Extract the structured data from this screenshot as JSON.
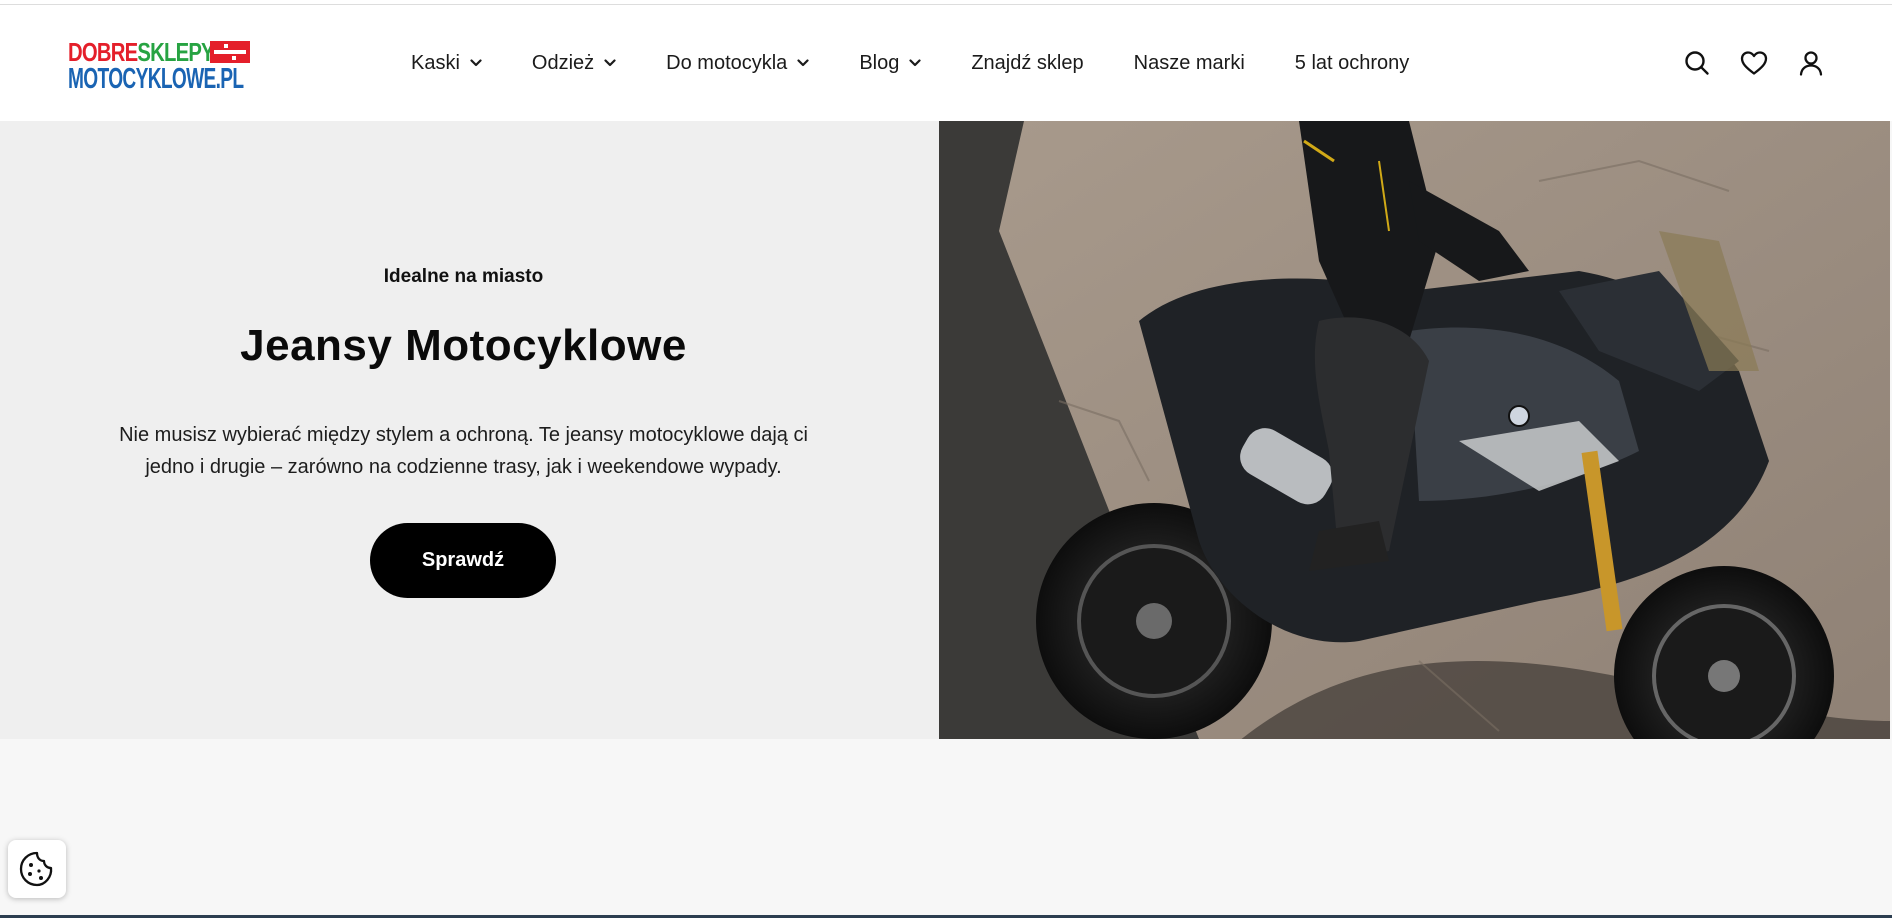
{
  "logo": {
    "line1_a": "DOBRE",
    "line1_b": "SKLEPY",
    "line2": "MOTOCYKLOWE.PL",
    "colors": {
      "red": "#e41f2a",
      "green": "#27a342",
      "blue": "#1a64b3"
    }
  },
  "nav": {
    "items": [
      {
        "label": "Kaski",
        "dropdown": true
      },
      {
        "label": "Odzież",
        "dropdown": true
      },
      {
        "label": "Do motocykla",
        "dropdown": true
      },
      {
        "label": "Blog",
        "dropdown": true
      },
      {
        "label": "Znajdź sklep",
        "dropdown": false
      },
      {
        "label": "Nasze marki",
        "dropdown": false
      },
      {
        "label": "5 lat ochrony",
        "dropdown": false
      }
    ]
  },
  "header_icons": [
    "search-icon",
    "heart-icon",
    "user-icon"
  ],
  "hero": {
    "eyebrow": "Idealne na miasto",
    "title": "Jeansy Motocyklowe",
    "description": "Nie musisz wybierać między stylem a ochroną. Te jeansy motocyklowe dają ci jedno i drugie – zarówno na codzienne trasy, jak i weekendowe wypady.",
    "cta_label": "Sprawdź",
    "image": "motorcycle-rider-photo"
  },
  "cookie_button": {
    "icon": "cookie-icon"
  }
}
